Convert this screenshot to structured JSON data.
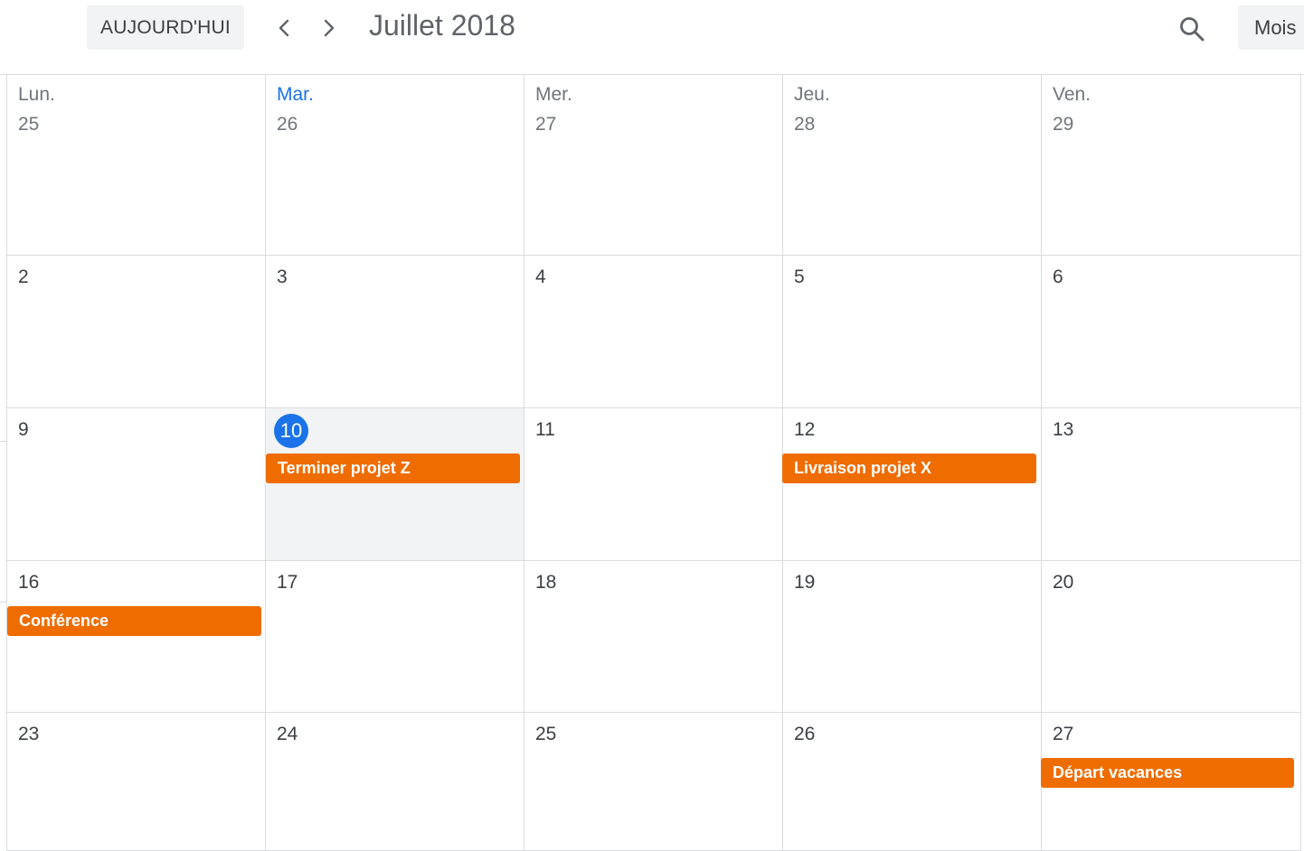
{
  "toolbar": {
    "today_label": "AUJOURD'HUI",
    "month_title": "Juillet 2018",
    "view_label": "Mois",
    "prev_icon": "chevron-left-icon",
    "next_icon": "chevron-right-icon",
    "search_icon": "search-icon"
  },
  "colors": {
    "accent": "#1a73e8",
    "event": "#ef6c00",
    "today_bg": "#f1f3f4",
    "grid_line": "#dadce0"
  },
  "calendar": {
    "day_names": [
      "Lun.",
      "Mar.",
      "Mer.",
      "Jeu.",
      "Ven."
    ],
    "active_day_name": "Mar.",
    "today": "10",
    "weeks": [
      [
        "25",
        "26",
        "27",
        "28",
        "29"
      ],
      [
        "2",
        "3",
        "4",
        "5",
        "6"
      ],
      [
        "9",
        "10",
        "11",
        "12",
        "13"
      ],
      [
        "16",
        "17",
        "18",
        "19",
        "20"
      ],
      [
        "23",
        "24",
        "25",
        "26",
        "27"
      ]
    ],
    "events": {
      "terminer_projet_z": {
        "day": "10",
        "title": "Terminer projet Z"
      },
      "livraison_projet_x": {
        "day": "12",
        "title": "Livraison projet X"
      },
      "conference": {
        "day": "16",
        "title": "Conférence"
      },
      "depart_vacances": {
        "day": "27",
        "title": "Départ vacances"
      }
    }
  }
}
